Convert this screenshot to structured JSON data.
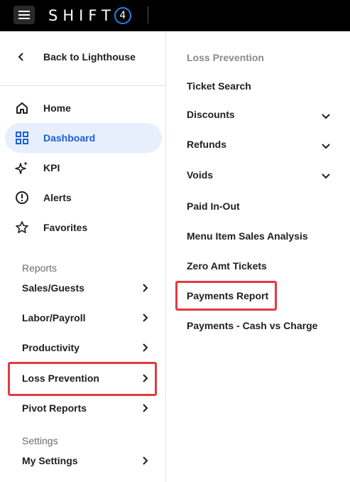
{
  "brand": {
    "name": "SHIFT",
    "badge": "4"
  },
  "left_nav": {
    "back": "Back to Lighthouse",
    "items": [
      {
        "label": "Home",
        "icon": "home-icon"
      },
      {
        "label": "Dashboard",
        "icon": "grid-icon",
        "active": true
      },
      {
        "label": "KPI",
        "icon": "sparkle-icon"
      },
      {
        "label": "Alerts",
        "icon": "alert-icon"
      },
      {
        "label": "Favorites",
        "icon": "star-icon"
      }
    ],
    "reports_header": "Reports",
    "reports": [
      {
        "label": "Sales/Guests"
      },
      {
        "label": "Labor/Payroll"
      },
      {
        "label": "Productivity"
      },
      {
        "label": "Loss Prevention",
        "highlighted": true
      },
      {
        "label": "Pivot Reports"
      }
    ],
    "settings_header": "Settings",
    "settings": [
      {
        "label": "My Settings"
      }
    ]
  },
  "submenu": {
    "title": "Loss Prevention",
    "items": [
      {
        "label": "Ticket Search"
      },
      {
        "label": "Discounts",
        "expandable": true
      },
      {
        "label": "Refunds",
        "expandable": true
      },
      {
        "label": "Voids",
        "expandable": true
      },
      {
        "label": "Paid In-Out"
      },
      {
        "label": "Menu Item Sales Analysis"
      },
      {
        "label": "Zero Amt Tickets"
      },
      {
        "label": "Payments Report",
        "highlighted": true
      },
      {
        "label": "Payments - Cash vs Charge"
      }
    ]
  },
  "colors": {
    "accent": "#1a5fd6",
    "active_bg": "#e7effc",
    "highlight": "#e53940",
    "topbar": "#000000"
  }
}
